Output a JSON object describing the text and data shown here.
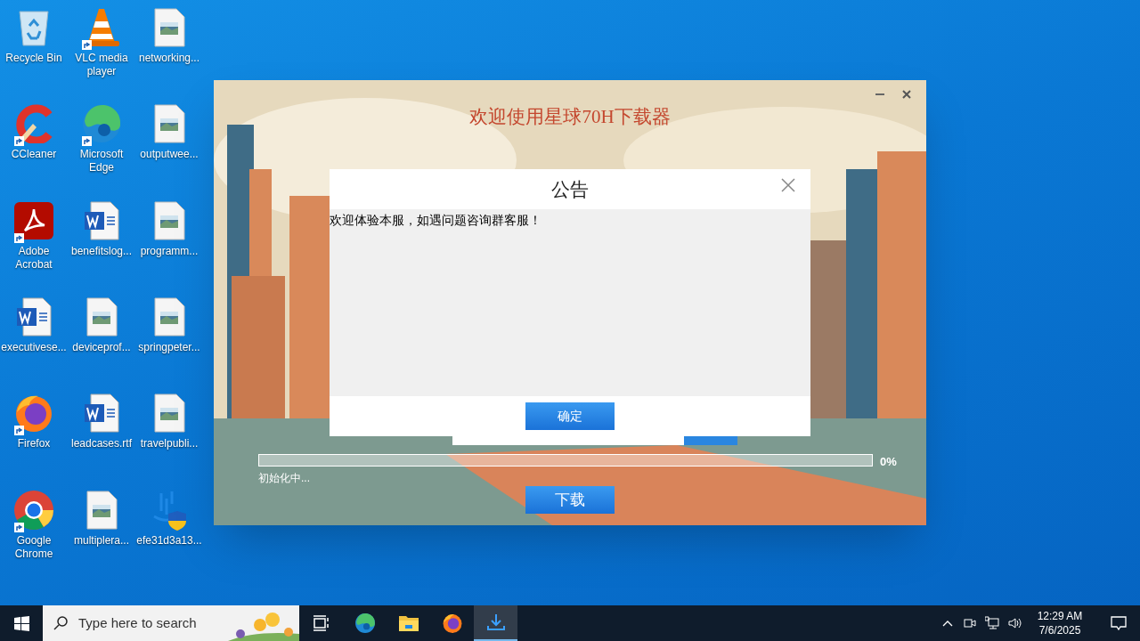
{
  "desktop_icons": [
    {
      "label": "Recycle Bin",
      "kind": "recycle-bin",
      "shortcut": false
    },
    {
      "label": "CCleaner",
      "kind": "ccleaner",
      "shortcut": true
    },
    {
      "label": "Adobe Acrobat",
      "kind": "acrobat",
      "shortcut": true
    },
    {
      "label": "executivese...",
      "kind": "word",
      "shortcut": false
    },
    {
      "label": "Firefox",
      "kind": "firefox",
      "shortcut": true
    },
    {
      "label": "Google Chrome",
      "kind": "chrome",
      "shortcut": true
    },
    {
      "label": "VLC media player",
      "kind": "vlc",
      "shortcut": true
    },
    {
      "label": "Microsoft Edge",
      "kind": "edge",
      "shortcut": true
    },
    {
      "label": "benefitslog...",
      "kind": "word",
      "shortcut": false
    },
    {
      "label": "deviceprof...",
      "kind": "image-file",
      "shortcut": false
    },
    {
      "label": "leadcases.rtf",
      "kind": "word",
      "shortcut": false
    },
    {
      "label": "multiplera...",
      "kind": "image-file",
      "shortcut": false
    },
    {
      "label": "networking...",
      "kind": "image-file",
      "shortcut": false
    },
    {
      "label": "outputwee...",
      "kind": "image-file",
      "shortcut": false
    },
    {
      "label": "programm...",
      "kind": "image-file",
      "shortcut": false
    },
    {
      "label": "springpeter...",
      "kind": "image-file",
      "shortcut": false
    },
    {
      "label": "travelpubli...",
      "kind": "image-file",
      "shortcut": false
    },
    {
      "label": "efe31d3a13...",
      "kind": "installer",
      "shortcut": false
    }
  ],
  "app_window": {
    "title": "欢迎使用星球70H下载器",
    "progress": {
      "level": 0,
      "reading": "0%"
    },
    "status_text": "初始化中...",
    "download_button": "下载",
    "dialog": {
      "title": "公告",
      "message": "欢迎体验本服，如遇问题咨询群客服！",
      "ok_button": "确定"
    }
  },
  "taskbar": {
    "search_placeholder": "Type here to search",
    "apps": [
      {
        "kind": "task-view",
        "selected": false
      },
      {
        "kind": "edge",
        "selected": false
      },
      {
        "kind": "explorer",
        "selected": false
      },
      {
        "kind": "firefox",
        "selected": false
      },
      {
        "kind": "downloader",
        "selected": true
      }
    ],
    "clock": {
      "time": "12:29 AM",
      "date": "7/6/2025"
    }
  }
}
